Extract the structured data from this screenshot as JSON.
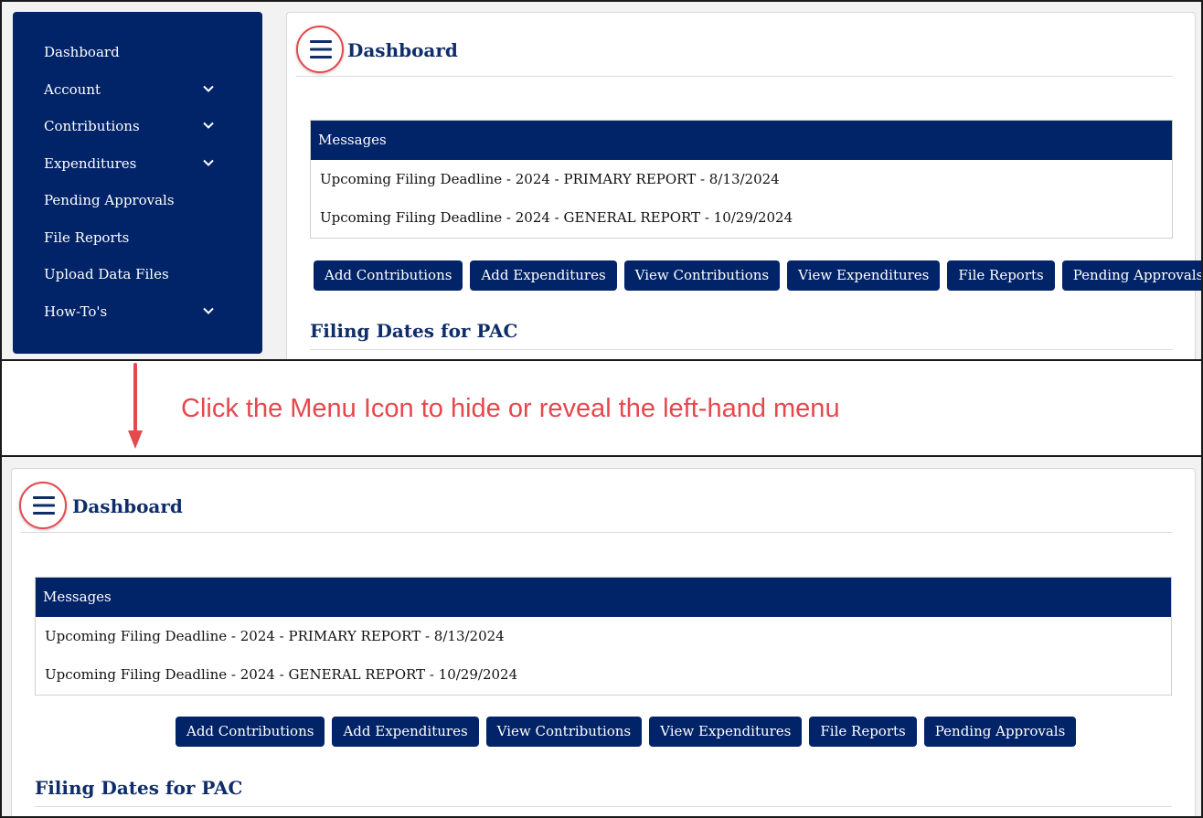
{
  "sidebar": {
    "items": [
      {
        "label": "Dashboard",
        "has_submenu": false
      },
      {
        "label": "Account",
        "has_submenu": true
      },
      {
        "label": "Contributions",
        "has_submenu": true
      },
      {
        "label": "Expenditures",
        "has_submenu": true
      },
      {
        "label": "Pending Approvals",
        "has_submenu": false
      },
      {
        "label": "File Reports",
        "has_submenu": false
      },
      {
        "label": "Upload Data Files",
        "has_submenu": false
      },
      {
        "label": "How-To's",
        "has_submenu": true
      }
    ]
  },
  "page": {
    "title": "Dashboard",
    "menu_icon": "hamburger-menu-icon"
  },
  "messages": {
    "header": "Messages",
    "items": [
      "Upcoming Filing Deadline - 2024 - PRIMARY REPORT - 8/13/2024",
      "Upcoming Filing Deadline - 2024 - GENERAL REPORT - 10/29/2024"
    ]
  },
  "actions": {
    "add_contributions": "Add Contributions",
    "add_expenditures": "Add Expenditures",
    "view_contributions": "View Contributions",
    "view_expenditures": "View Expenditures",
    "file_reports": "File Reports",
    "pending_approvals": "Pending Approvals"
  },
  "filing_section": {
    "title": "Filing Dates for PAC"
  },
  "annotation": {
    "instruction": "Click the Menu Icon to hide or reveal the left-hand menu",
    "color": "#e5484d"
  },
  "colors": {
    "brand_navy": "#012367",
    "heading_navy": "#0f2d69",
    "highlight_red": "#e5484d"
  }
}
